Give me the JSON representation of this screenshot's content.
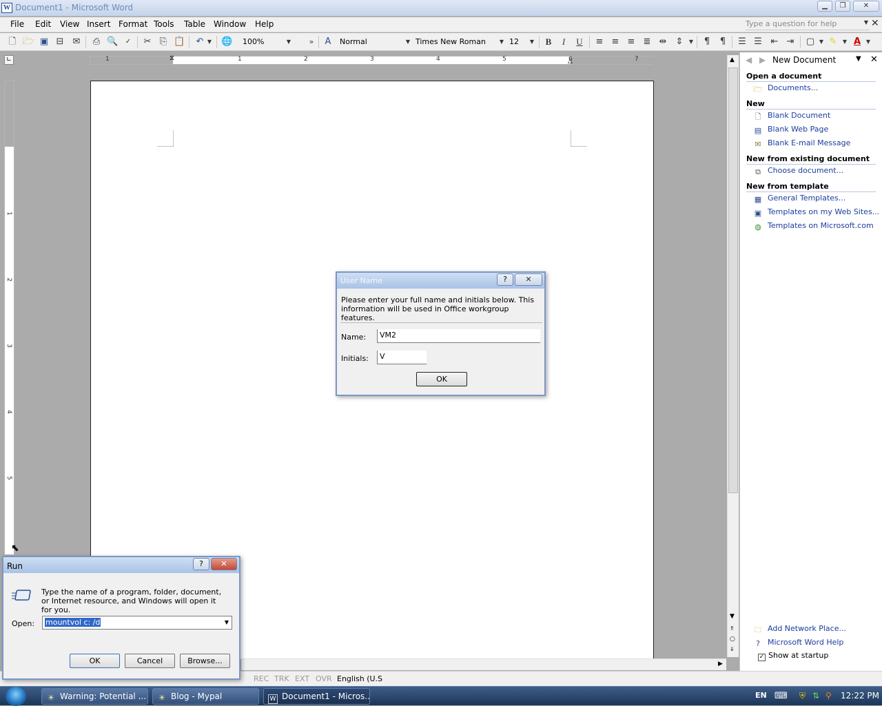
{
  "window": {
    "title": "Document1 - Microsoft Word",
    "app_icon": "W"
  },
  "menu": [
    "File",
    "Edit",
    "View",
    "Insert",
    "Format",
    "Tools",
    "Table",
    "Window",
    "Help"
  ],
  "help_box": {
    "placeholder": "Type a question for help"
  },
  "toolbar": {
    "zoom": "100%",
    "style": "Normal",
    "font": "Times New Roman",
    "size": "12",
    "bold": "B",
    "italic": "I",
    "underline": "U"
  },
  "ruler": {
    "h_numbers": [
      "1",
      "1",
      "2",
      "3",
      "4",
      "5",
      "6",
      "7"
    ],
    "v_numbers": [
      "1",
      "2",
      "3",
      "4",
      "5"
    ]
  },
  "task_pane": {
    "title": "New Document",
    "sections": [
      {
        "heading": "Open a document",
        "items": [
          {
            "label": "Documents...",
            "icon": "folder-icon"
          }
        ]
      },
      {
        "heading": "New",
        "items": [
          {
            "label": "Blank Document",
            "icon": "blank-document-icon"
          },
          {
            "label": "Blank Web Page",
            "icon": "web-page-icon"
          },
          {
            "label": "Blank E-mail Message",
            "icon": "email-icon"
          }
        ]
      },
      {
        "heading": "New from existing document",
        "items": [
          {
            "label": "Choose document...",
            "icon": "existing-document-icon"
          }
        ]
      },
      {
        "heading": "New from template",
        "items": [
          {
            "label": "General Templates...",
            "icon": "template-icon"
          },
          {
            "label": "Templates on my Web Sites...",
            "icon": "web-templates-icon"
          },
          {
            "label": "Templates on Microsoft.com",
            "icon": "globe-icon"
          }
        ]
      }
    ],
    "footer": {
      "add_network_place": "Add Network Place...",
      "word_help": "Microsoft Word Help",
      "show_at_startup": "Show at startup"
    }
  },
  "username_dialog": {
    "title": "User Name",
    "message": "Please enter your full name and initials below.  This information will be used in Office workgroup features.",
    "name_label": "Name:",
    "name_value": "VM2",
    "initials_label": "Initials:",
    "initials_value": "V",
    "ok": "OK"
  },
  "run_dialog": {
    "title": "Run",
    "message": "Type the name of a program, folder, document, or Internet resource, and Windows will open it for you.",
    "open_label": "Open:",
    "open_value": "mountvol c: /d",
    "ok": "OK",
    "cancel": "Cancel",
    "browse": "Browse..."
  },
  "status_bar": {
    "rec": "REC",
    "trk": "TRK",
    "ext": "EXT",
    "ovr": "OVR",
    "language": "English (U.S"
  },
  "taskbar": {
    "buttons": [
      {
        "label": "Warning: Potential ..."
      },
      {
        "label": "Blog - Mypal"
      },
      {
        "label": "Document1 - Micros..."
      }
    ],
    "language": "EN",
    "clock": "12:22 PM"
  },
  "colors": {
    "link": "#1b3c9c",
    "dialog_border": "#7b97c5",
    "taskbar": "#1c3557"
  }
}
